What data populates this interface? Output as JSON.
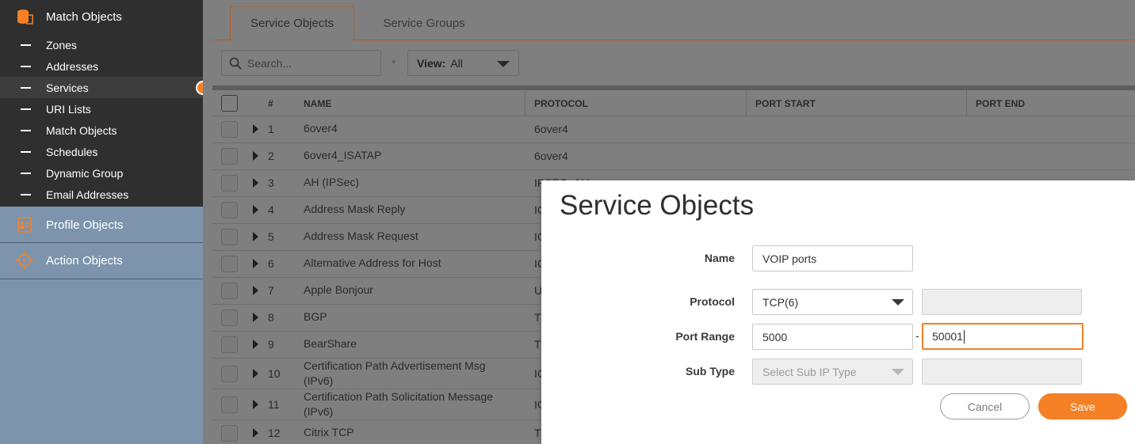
{
  "sidebar": {
    "match_objects": "Match Objects",
    "items": [
      {
        "label": "Zones"
      },
      {
        "label": "Addresses"
      },
      {
        "label": "Services"
      },
      {
        "label": "URI Lists"
      },
      {
        "label": "Match Objects"
      },
      {
        "label": "Schedules"
      },
      {
        "label": "Dynamic Group"
      },
      {
        "label": "Email Addresses"
      }
    ],
    "active_item": "Services",
    "profile_objects": "Profile Objects",
    "action_objects": "Action Objects"
  },
  "tabs": [
    {
      "label": "Service Objects",
      "active": true
    },
    {
      "label": "Service Groups",
      "active": false
    }
  ],
  "toolbar": {
    "search_placeholder": "Search...",
    "view_label": "View:",
    "view_value": "All"
  },
  "table": {
    "headers": {
      "num": "#",
      "name": "NAME",
      "protocol": "PROTOCOL",
      "port_start": "PORT START",
      "port_end": "PORT END"
    },
    "rows": [
      {
        "num": "1",
        "name": "6over4",
        "protocol": "6over4"
      },
      {
        "num": "2",
        "name": "6over4_ISATAP",
        "protocol": "6over4"
      },
      {
        "num": "3",
        "name": "AH (IPSec)",
        "protocol": "IPSEC_AH"
      },
      {
        "num": "4",
        "name": "Address Mask Reply",
        "protocol": "IC"
      },
      {
        "num": "5",
        "name": "Address Mask Request",
        "protocol": "IC"
      },
      {
        "num": "6",
        "name": "Alternative Address for Host",
        "protocol": "IC"
      },
      {
        "num": "7",
        "name": "Apple Bonjour",
        "protocol": "U"
      },
      {
        "num": "8",
        "name": "BGP",
        "protocol": "T"
      },
      {
        "num": "9",
        "name": "BearShare",
        "protocol": "T"
      },
      {
        "num": "10",
        "name": "Certification Path Advertisement Msg (IPv6)",
        "protocol": "IC"
      },
      {
        "num": "11",
        "name": "Certification Path Solicitation Message (IPv6)",
        "protocol": "IC"
      },
      {
        "num": "12",
        "name": "Citrix TCP",
        "protocol": "T"
      }
    ]
  },
  "modal": {
    "title": "Service Objects",
    "name_label": "Name",
    "name_value": "VOIP ports",
    "protocol_label": "Protocol",
    "protocol_value": "TCP(6)",
    "port_range_label": "Port Range",
    "port_start": "5000",
    "port_sep": "-",
    "port_end": "50001",
    "subtype_label": "Sub Type",
    "subtype_placeholder": "Select Sub IP Type",
    "cancel": "Cancel",
    "save": "Save"
  },
  "colors": {
    "accent": "#f58025",
    "sidebar_dark": "#2f2f2f",
    "sidebar_light": "#7d94ac"
  }
}
